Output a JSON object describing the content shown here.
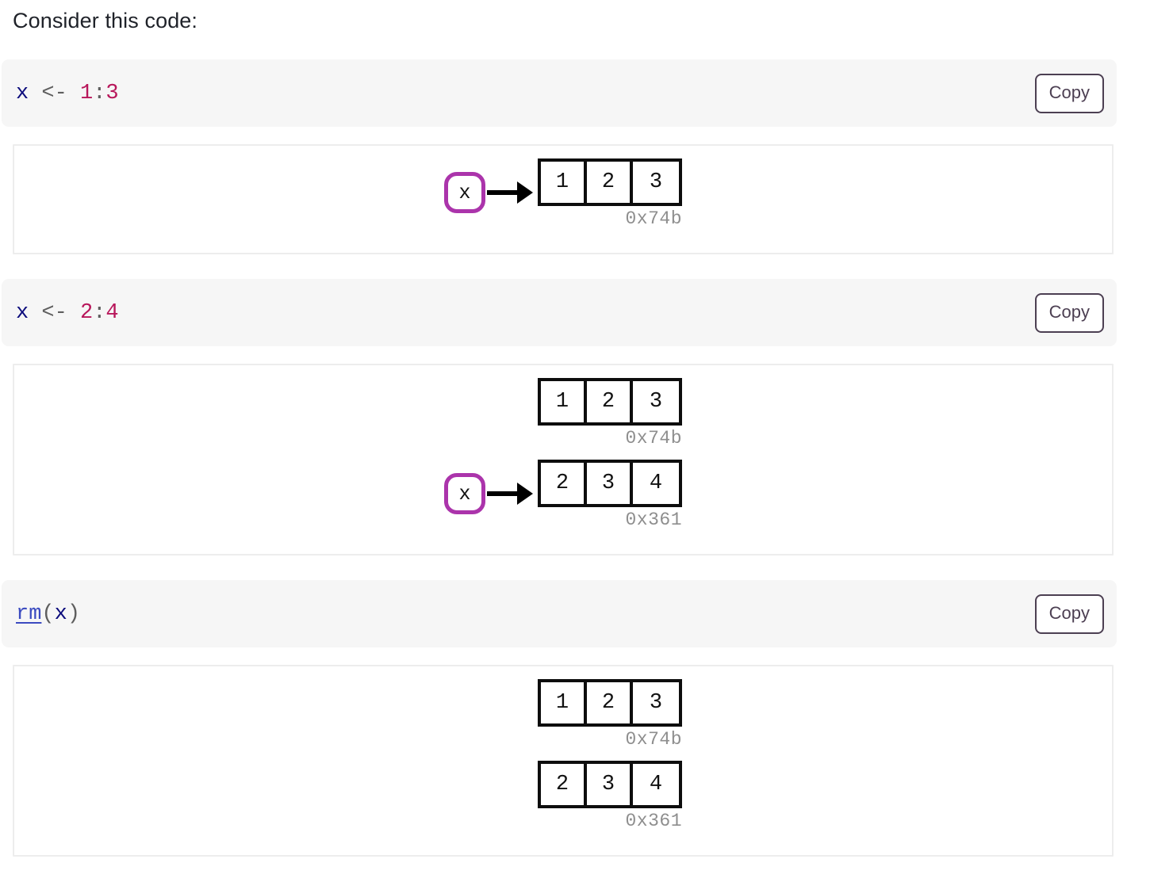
{
  "intro": {
    "text": "Consider this code:"
  },
  "copy_label": "Copy",
  "colors": {
    "binding_purple": "#ab34ab",
    "vector_black": "#0d0d0d",
    "address_gray": "#8e8e8e",
    "code_bg": "#f6f6f6",
    "code_var_blue": "#0c0c7c",
    "code_num_crimson": "#b8175b",
    "code_operator_gray": "#5e5e5e",
    "code_function_blue": "#3b4bc0",
    "button_border": "#4c3f52",
    "figure_border": "#ededed"
  },
  "steps": [
    {
      "code": {
        "tokens": [
          {
            "text": "x",
            "type": "var"
          },
          {
            "text": " ",
            "type": "plain"
          },
          {
            "text": "<-",
            "type": "op"
          },
          {
            "text": " ",
            "type": "plain"
          },
          {
            "text": "1",
            "type": "num"
          },
          {
            "text": ":",
            "type": "punct"
          },
          {
            "text": "3",
            "type": "num"
          }
        ],
        "plain": "x <- 1:3"
      },
      "diagram": {
        "rows": [
          {
            "binding": "x",
            "has_arrow": true,
            "cells": [
              "1",
              "2",
              "3"
            ],
            "address": "0x74b"
          }
        ]
      }
    },
    {
      "code": {
        "tokens": [
          {
            "text": "x",
            "type": "var"
          },
          {
            "text": " ",
            "type": "plain"
          },
          {
            "text": "<-",
            "type": "op"
          },
          {
            "text": " ",
            "type": "plain"
          },
          {
            "text": "2",
            "type": "num"
          },
          {
            "text": ":",
            "type": "punct"
          },
          {
            "text": "4",
            "type": "num"
          }
        ],
        "plain": "x <- 2:4"
      },
      "diagram": {
        "rows": [
          {
            "binding": null,
            "has_arrow": false,
            "cells": [
              "1",
              "2",
              "3"
            ],
            "address": "0x74b"
          },
          {
            "binding": "x",
            "has_arrow": true,
            "cells": [
              "2",
              "3",
              "4"
            ],
            "address": "0x361"
          }
        ]
      }
    },
    {
      "code": {
        "tokens": [
          {
            "text": "rm",
            "type": "fun"
          },
          {
            "text": "(",
            "type": "punct"
          },
          {
            "text": "x",
            "type": "var"
          },
          {
            "text": ")",
            "type": "punct"
          }
        ],
        "plain": "rm(x)"
      },
      "diagram": {
        "rows": [
          {
            "binding": null,
            "has_arrow": false,
            "cells": [
              "1",
              "2",
              "3"
            ],
            "address": "0x74b"
          },
          {
            "binding": null,
            "has_arrow": false,
            "cells": [
              "2",
              "3",
              "4"
            ],
            "address": "0x361"
          }
        ]
      }
    }
  ]
}
